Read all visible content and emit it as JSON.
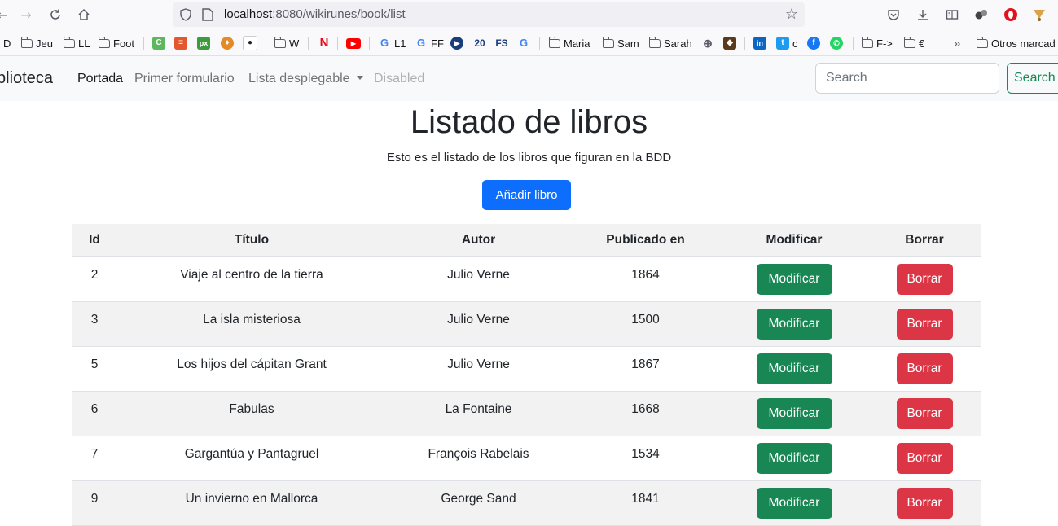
{
  "browser": {
    "url_host": "localhost",
    "url_path": ":8080/wikirunes/book/list"
  },
  "bookmarks": [
    {
      "label": "D"
    },
    {
      "label": "Jeu"
    },
    {
      "label": "LL"
    },
    {
      "label": "Foot"
    },
    {
      "label": "W"
    },
    {
      "label": "L1"
    },
    {
      "label": "FF"
    },
    {
      "label": "Maria"
    },
    {
      "label": "Sam"
    },
    {
      "label": "Sarah"
    },
    {
      "label": "c"
    },
    {
      "label": "F->"
    },
    {
      "label": "€"
    },
    {
      "label": "Otros marcad"
    }
  ],
  "navbar": {
    "brand": "blioteca",
    "links": [
      "Portada",
      "Primer formulario",
      "Lista desplegable",
      "Disabled"
    ],
    "search_placeholder": "Search",
    "search_button": "Search"
  },
  "page": {
    "title": "Listado de libros",
    "subtitle": "Esto es el listado de los libros que figuran en la BDD",
    "add_button": "Añadir libro"
  },
  "table": {
    "headers": [
      "Id",
      "Título",
      "Autor",
      "Publicado en",
      "Modificar",
      "Borrar"
    ],
    "modify_label": "Modificar",
    "delete_label": "Borrar",
    "rows": [
      {
        "id": "2",
        "titulo": "Viaje al centro de la tierra",
        "autor": "Julio Verne",
        "publicado": "1864"
      },
      {
        "id": "3",
        "titulo": "La isla misteriosa",
        "autor": "Julio Verne",
        "publicado": "1500"
      },
      {
        "id": "5",
        "titulo": "Los hijos del cápitan Grant",
        "autor": "Julio Verne",
        "publicado": "1867"
      },
      {
        "id": "6",
        "titulo": "Fabulas",
        "autor": "La Fontaine",
        "publicado": "1668"
      },
      {
        "id": "7",
        "titulo": "Gargantúa y Pantagruel",
        "autor": "François Rabelais",
        "publicado": "1534"
      },
      {
        "id": "9",
        "titulo": "Un invierno en Mallorca",
        "autor": "George Sand",
        "publicado": "1841"
      }
    ]
  }
}
